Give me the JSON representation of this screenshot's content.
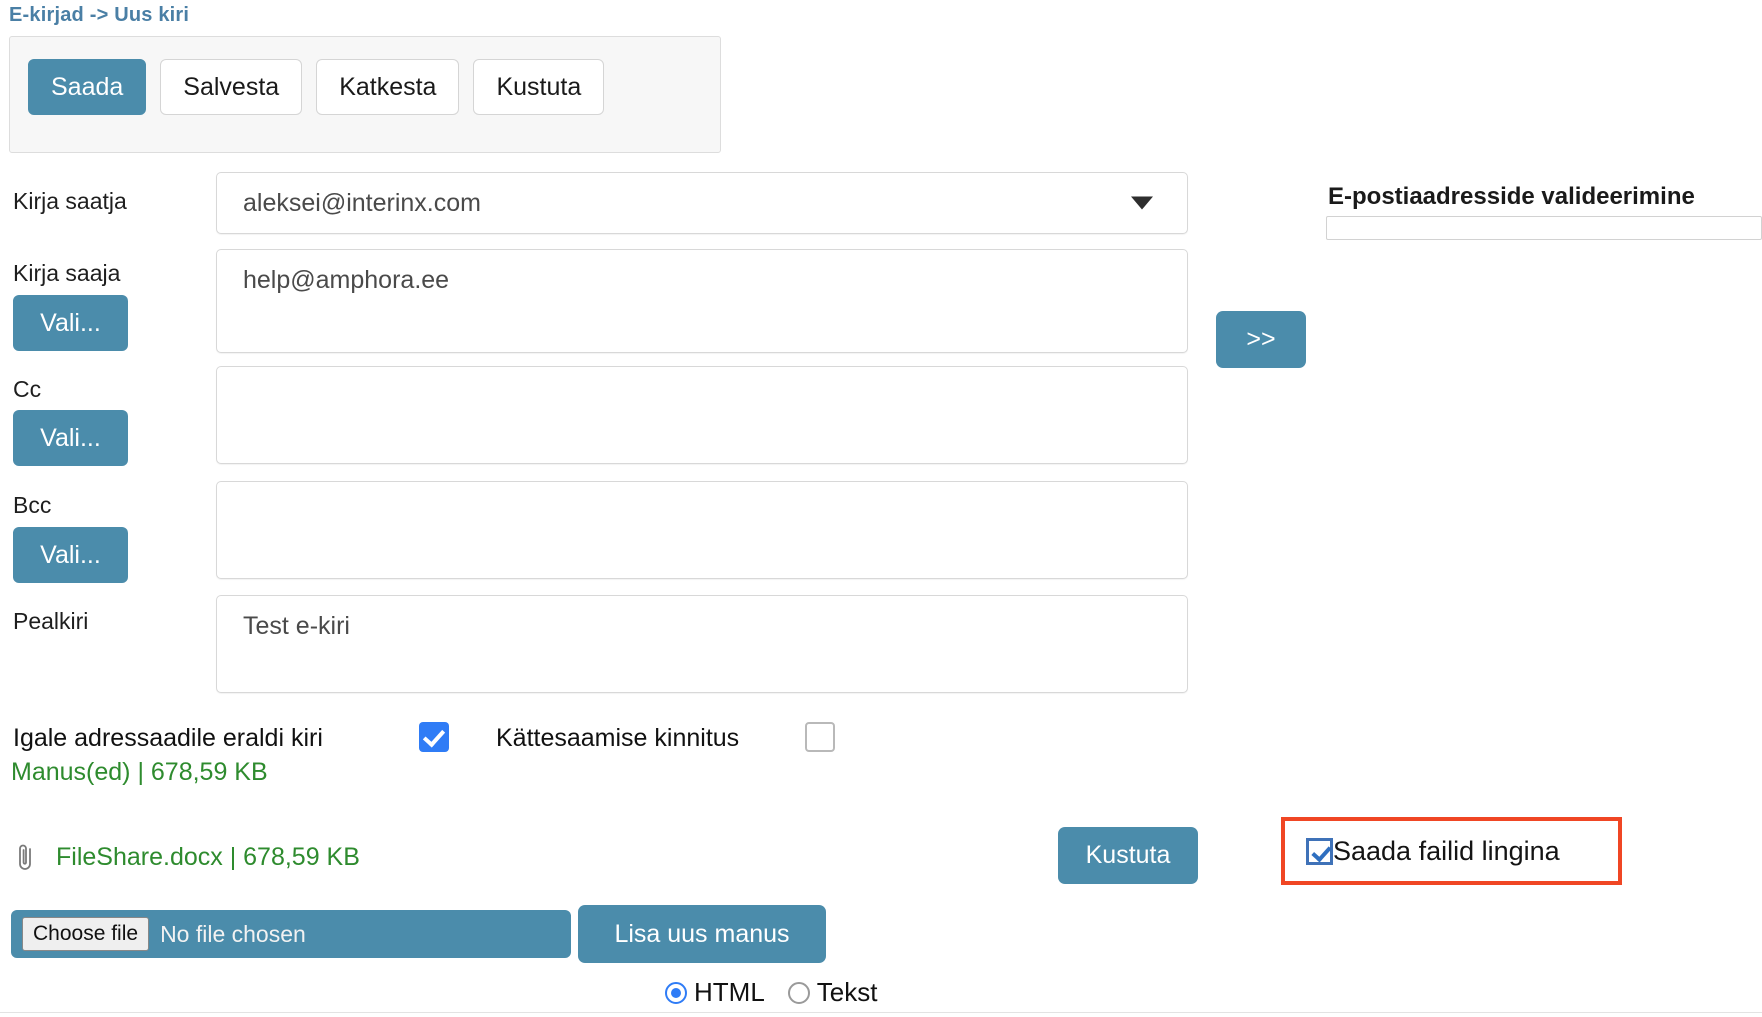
{
  "page": {
    "title": "E-kirjad -> Uus kiri",
    "title_color": "#4a7fa5",
    "accent_color": "#4b8cab",
    "attachment_color": "#2e8b2e",
    "highlight_color": "#f04624"
  },
  "toolbar": {
    "buttons": [
      {
        "label": "Saada",
        "style": "primary"
      },
      {
        "label": "Salvesta",
        "style": "plain"
      },
      {
        "label": "Katkesta",
        "style": "plain"
      },
      {
        "label": "Kustuta",
        "style": "plain"
      }
    ]
  },
  "form": {
    "sender": {
      "label": "Kirja saatja",
      "value": "aleksei@interinx.com",
      "icon": "chevron-down-icon"
    },
    "to": {
      "label": "Kirja saaja",
      "value": "help@amphora.ee",
      "picker_label": "Vali..."
    },
    "cc": {
      "label": "Cc",
      "value": "",
      "picker_label": "Vali..."
    },
    "bcc": {
      "label": "Bcc",
      "value": "",
      "picker_label": "Vali..."
    },
    "subject": {
      "label": "Pealkiri",
      "value": "Test e-kiri"
    },
    "move_button_label": ">>"
  },
  "validation": {
    "title": "E-postiaadresside valideerimine",
    "value": ""
  },
  "options": {
    "separate_mail": {
      "label": "Igale adressaadile eraldi kiri",
      "checked": true
    },
    "receipt_confirmation": {
      "label": "Kättesaamise kinnitus",
      "checked": false
    }
  },
  "attachments": {
    "summary": "Manus(ed) | 678,59 KB",
    "items": [
      {
        "icon": "paperclip-icon",
        "name": "FileShare.docx",
        "size": "678,59 KB",
        "display": "FileShare.docx | 678,59 KB"
      }
    ],
    "delete_label": "Kustuta",
    "send_as_link": {
      "label": "Saada failid lingina",
      "checked": true
    },
    "file_input": {
      "button_label": "Choose file",
      "status": "No file chosen"
    },
    "add_label": "Lisa uus manus"
  },
  "format": {
    "options": [
      {
        "label": "HTML",
        "selected": true
      },
      {
        "label": "Tekst",
        "selected": false
      }
    ]
  }
}
